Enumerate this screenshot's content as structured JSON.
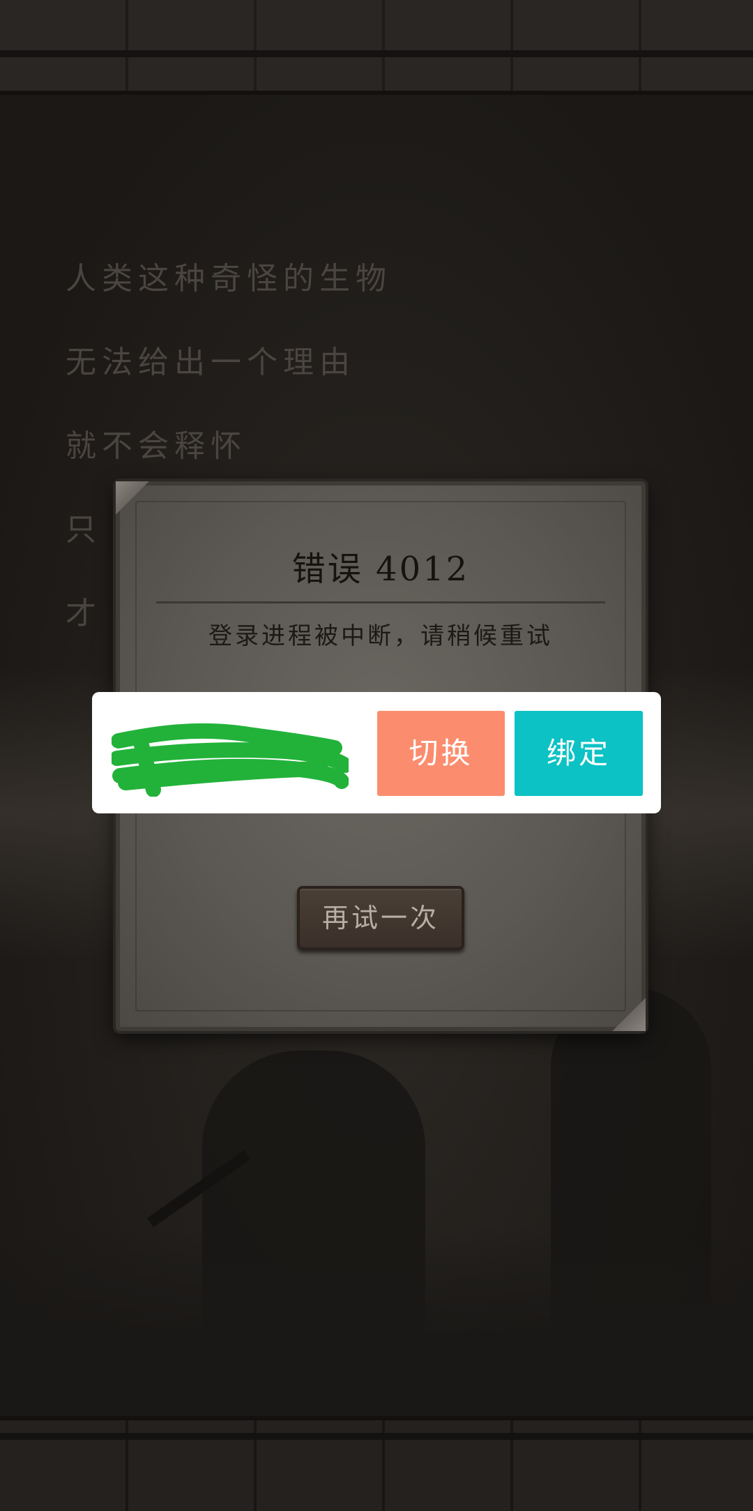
{
  "story": {
    "lines": [
      "人类这种奇怪的生物",
      "无法给出一个理由",
      "就不会释怀",
      "只",
      "才"
    ]
  },
  "dialog": {
    "title": "错误 4012",
    "message": "登录进程被中断，请稍候重试",
    "retry_label": "再试一次"
  },
  "account_bar": {
    "switch_label": "切换",
    "bind_label": "绑定",
    "switch_color": "#fb8d6e",
    "bind_color": "#0cc2c4",
    "redaction_color": "#22b23a"
  }
}
